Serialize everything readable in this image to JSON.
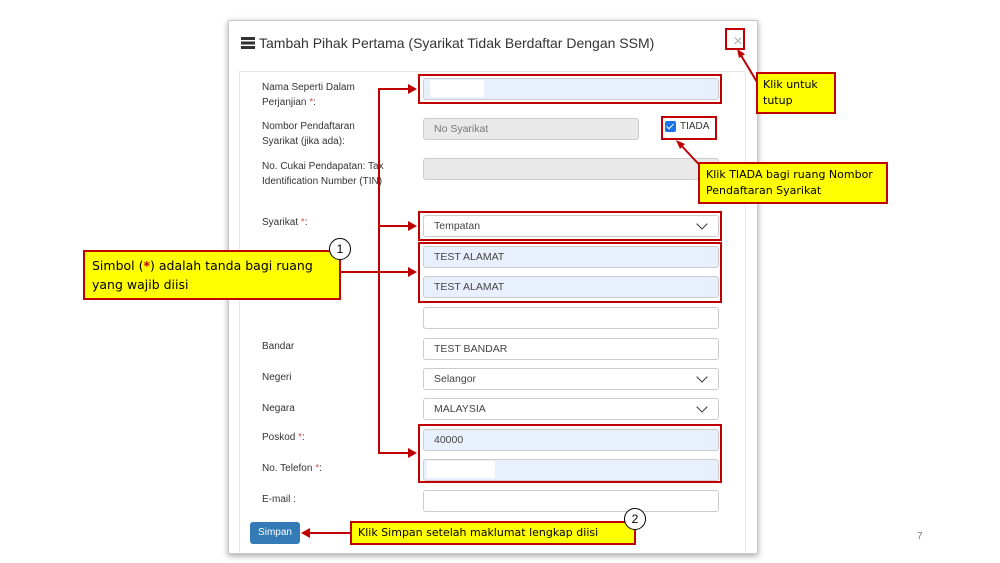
{
  "modal": {
    "title": "Tambah Pihak Pertama (Syarikat Tidak Berdaftar Dengan SSM)",
    "close_symbol": "×"
  },
  "form": {
    "nama": {
      "label": "Nama Seperti Dalam Perjanjian",
      "required_mark": "*",
      "suffix": ":",
      "value": ""
    },
    "no_pendaftaran": {
      "label": "Nombor Pendaftaran Syarikat (jika ada):",
      "placeholder": "No Syarikat",
      "checkbox_label": "TIADA",
      "checked": true
    },
    "no_cukai": {
      "label": "No. Cukai Pendapatan: Tax Identification Number (TIN)",
      "value": ""
    },
    "syarikat": {
      "label": "Syarikat",
      "required_mark": "*",
      "suffix": ":",
      "selected": "Tempatan"
    },
    "alamat1": {
      "value": "TEST ALAMAT"
    },
    "alamat2": {
      "value": "TEST ALAMAT"
    },
    "alamat3": {
      "value": ""
    },
    "bandar": {
      "label": "Bandar",
      "value": "TEST BANDAR"
    },
    "negeri": {
      "label": "Negeri",
      "selected": "Selangor"
    },
    "negara": {
      "label": "Negara",
      "selected": "MALAYSIA"
    },
    "poskod": {
      "label": "Poskod",
      "required_mark": "*",
      "suffix": ":",
      "value": "40000"
    },
    "telefon": {
      "label": "No. Telefon",
      "required_mark": "*",
      "suffix": ":",
      "value": ""
    },
    "email": {
      "label": "E-mail :",
      "value": ""
    },
    "submit_label": "Simpan"
  },
  "annotations": {
    "close_note": "Klik untuk tutup",
    "tiada_note": "Klik TIADA bagi ruang Nombor Pendaftaran Syarikat",
    "required_note_pre": "Simbol (",
    "required_note_star": "*",
    "required_note_post": ") adalah tanda bagi ruang yang wajib diisi",
    "simpan_note": "Klik Simpan setelah maklumat lengkap diisi",
    "step1": "1",
    "step2": "2"
  },
  "colors": {
    "annotation_red": "#c00000",
    "callout_yellow": "#ffff00",
    "button_blue": "#337ab7"
  },
  "page_number": "7"
}
